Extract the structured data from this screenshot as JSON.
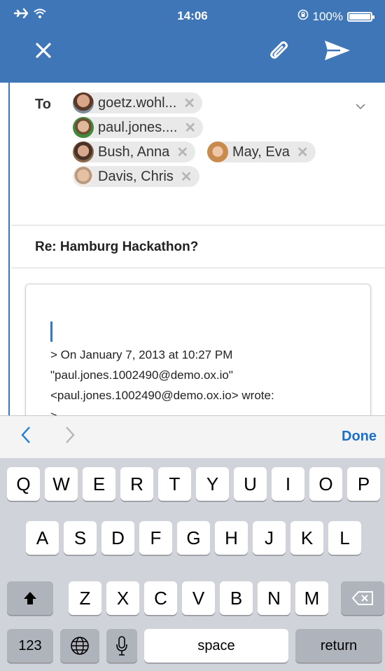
{
  "status_bar": {
    "time": "14:06",
    "battery_text": "100%"
  },
  "to_field": {
    "label": "To",
    "recipients": [
      {
        "name": "goetz.wohl..."
      },
      {
        "name": "paul.jones...."
      },
      {
        "name": "Bush, Anna"
      },
      {
        "name": "May, Eva"
      },
      {
        "name": "Davis, Chris"
      }
    ]
  },
  "subject": "Re: Hamburg Hackathon?",
  "body": {
    "quote_lines": [
      "> On January 7, 2013 at 10:27 PM",
      "\"paul.jones.1002490@demo.ox.io\"",
      "<paul.jones.1002490@demo.ox.io> wrote:",
      ">"
    ]
  },
  "accessory": {
    "done_label": "Done"
  },
  "keyboard": {
    "row1": [
      "Q",
      "W",
      "E",
      "R",
      "T",
      "Y",
      "U",
      "I",
      "O",
      "P"
    ],
    "row2": [
      "A",
      "S",
      "D",
      "F",
      "G",
      "H",
      "J",
      "K",
      "L"
    ],
    "row3": [
      "Z",
      "X",
      "C",
      "V",
      "B",
      "N",
      "M"
    ],
    "numbers_label": "123",
    "space_label": "space",
    "return_label": "return"
  },
  "colors": {
    "header": "#3f76b8",
    "accent": "#1e6fc8",
    "keyboard_bg": "#d0d3d9"
  }
}
